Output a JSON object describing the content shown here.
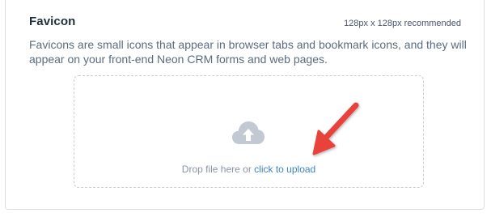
{
  "favicon": {
    "title": "Favicon",
    "recommendation": "128px x 128px recommended",
    "description": "Favicons are small icons that appear in browser tabs and bookmark icons, and they will appear on your front-end Neon CRM forms and web pages.",
    "dropzone": {
      "icon": "cloud-upload-icon",
      "prompt": "Drop file here or",
      "link_label": "click to upload"
    }
  },
  "annotation": {
    "icon": "red-arrow",
    "color": "#e8423a"
  }
}
